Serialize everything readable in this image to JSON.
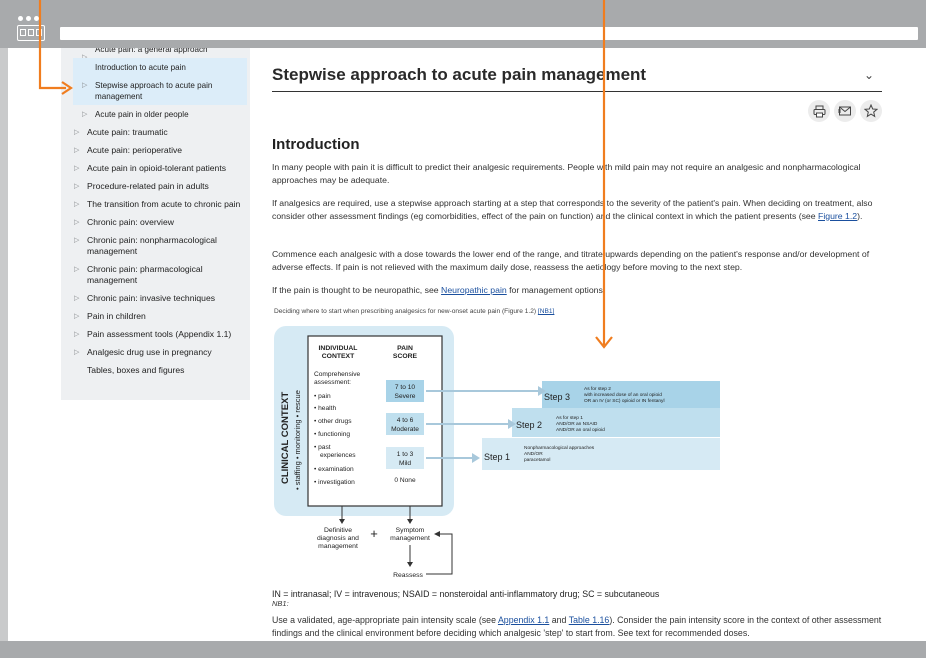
{
  "sidebar": {
    "items": [
      {
        "label": "Acute pain: a general approach",
        "level": "sub",
        "highlight": false,
        "clipped": true
      },
      {
        "label": "Introduction to acute pain",
        "level": "sub2",
        "highlight": true
      },
      {
        "label": "Stepwise approach to acute pain management",
        "level": "sub",
        "highlight": true
      },
      {
        "label": "Acute pain in older people",
        "level": "sub",
        "highlight": false
      },
      {
        "label": "Acute pain: traumatic",
        "level": "top",
        "highlight": false
      },
      {
        "label": "Acute pain: perioperative",
        "level": "top",
        "highlight": false
      },
      {
        "label": "Acute pain in opioid-tolerant patients",
        "level": "top",
        "highlight": false
      },
      {
        "label": "Procedure-related pain in adults",
        "level": "top",
        "highlight": false
      },
      {
        "label": "The transition from acute to chronic pain",
        "level": "top",
        "highlight": false
      },
      {
        "label": "Chronic pain: overview",
        "level": "top",
        "highlight": false
      },
      {
        "label": "Chronic pain: nonpharmacological management",
        "level": "top",
        "highlight": false
      },
      {
        "label": "Chronic pain: pharmacological management",
        "level": "top",
        "highlight": false
      },
      {
        "label": "Chronic pain: invasive techniques",
        "level": "top",
        "highlight": false
      },
      {
        "label": "Pain in children",
        "level": "top",
        "highlight": false
      },
      {
        "label": "Pain assessment tools (Appendix 1.1)",
        "level": "top",
        "highlight": false
      },
      {
        "label": "Analgesic drug use in pregnancy",
        "level": "top",
        "highlight": false
      },
      {
        "label": "Tables, boxes and figures",
        "level": "plain",
        "highlight": false
      }
    ]
  },
  "main": {
    "title": "Stepwise approach to acute pain management",
    "heading": "Introduction",
    "para1": "In many people with pain it is difficult to predict their analgesic requirements. People with mild pain may not require an analgesic and nonpharmacological approaches may be adequate.",
    "para2_pre": "If analgesics are required, use a stepwise approach starting at a step that corresponds to the severity of the patient's pain. When deciding on treatment, also consider other assessment findings (eg comorbidities, effect of the pain on function) and the clinical context in which the patient presents (see ",
    "para2_link": "Figure 1.2",
    "para2_post": ").",
    "para3": "Commence each analgesic with a dose towards the lower end of the range, and titrate upwards depending on the patient's response and/or development of adverse effects. If pain is not relieved with the maximum daily dose, reassess the aetiology before moving to the next step.",
    "para4_pre": "If the pain is thought to be neuropathic, see ",
    "para4_link": "Neuropathic pain",
    "para4_post": " for management options.",
    "caption_pre": "Deciding where to start when prescribing analgesics for new-onset acute pain (Figure 1.2) ",
    "caption_link": "[NB1]",
    "abbreviations": "IN = intranasal; IV = intravenous; NSAID = nonsteroidal anti-inflammatory drug; SC = subcutaneous",
    "nb": "NB1:",
    "para5_pre": "Use a validated, age-appropriate pain intensity scale (see ",
    "para5_link1": "Appendix 1.1",
    "para5_mid": " and ",
    "para5_link2": "Table 1.16",
    "para5_post": "). Consider the pain intensity score in the context of other assessment findings and the clinical environment before deciding which analgesic 'step' to start from. See text for recommended doses."
  },
  "figure": {
    "clinical_context": "CLINICAL CONTEXT",
    "clinical_sub": "• staffing  • monitoring  • rescue",
    "individual_context": [
      "INDIVIDUAL",
      "CONTEXT"
    ],
    "pain_score_head": [
      "PAIN",
      "SCORE"
    ],
    "assessment_head": [
      "Comprehensive",
      "assessment:"
    ],
    "assessment_items": [
      "• pain",
      "• health",
      "• other drugs",
      "• functioning",
      "• past",
      "experiences",
      "• examination",
      "• investigation"
    ],
    "scores": [
      {
        "range": "7 to 10",
        "label": "Severe"
      },
      {
        "range": "4 to 6",
        "label": "Moderate"
      },
      {
        "range": "1 to 3",
        "label": "Mild"
      },
      {
        "range": "0 None",
        "label": ""
      }
    ],
    "steps": [
      {
        "name": "Step 3",
        "lines": [
          "As for step 2",
          "with increased dose of an oral opioid",
          "OR an IV (or SC) opioid or IN fentanyl"
        ]
      },
      {
        "name": "Step 2",
        "lines": [
          "As for step 1",
          "AND/OR an NSAID",
          "AND/OR an oral opioid"
        ]
      },
      {
        "name": "Step 1",
        "lines": [
          "Nonpharmacological approaches",
          "AND/OR",
          "paracetamol"
        ]
      }
    ],
    "definitive": [
      "Definitive",
      "diagnosis and",
      "management"
    ],
    "plus": "+",
    "symptom": [
      "Symptom",
      "management"
    ],
    "reassess": "Reassess"
  },
  "colors": {
    "accent_orange": "#f07d1f",
    "link_blue": "#1a4f9e",
    "figure_blue_light": "#d6eaf4",
    "figure_blue_mid": "#a8d3e8"
  }
}
